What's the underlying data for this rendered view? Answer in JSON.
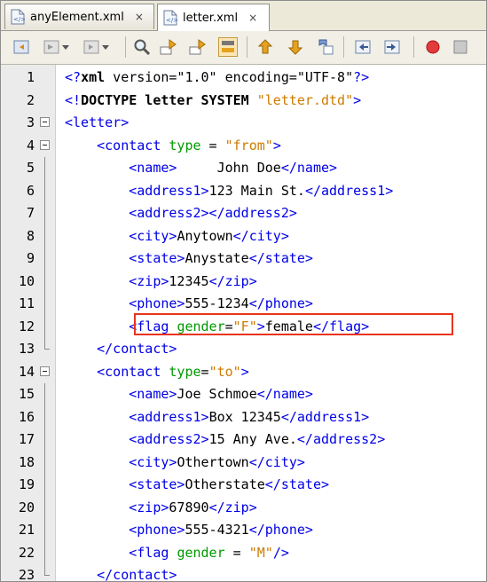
{
  "tabs": [
    {
      "label": "anyElement.xml",
      "close": "×"
    },
    {
      "label": "letter.xml",
      "close": "×"
    }
  ],
  "toolbar": {
    "icons": [
      "back-icon",
      "forward-icon",
      "history-icon",
      "find-icon",
      "find-previous-icon",
      "find-next-icon",
      "toggle-highlight-icon",
      "previous-bookmark-icon",
      "next-bookmark-icon",
      "toggle-bookmark-icon",
      "shift-left-icon",
      "shift-right-icon",
      "record-macro-icon",
      "stop-macro-icon"
    ]
  },
  "editor": {
    "lines": [
      {
        "n": "1",
        "parts": [
          [
            "tag",
            "<?"
          ],
          [
            "declkw",
            "xml"
          ],
          [
            "decl",
            " version=\"1.0\" encoding=\"UTF-8\""
          ],
          [
            "tag",
            "?>"
          ]
        ]
      },
      {
        "n": "2",
        "parts": [
          [
            "tag",
            "<!"
          ],
          [
            "declkw",
            "DOCTYPE letter SYSTEM "
          ],
          [
            "val",
            "\"letter.dtd\""
          ],
          [
            "tag",
            ">"
          ]
        ]
      },
      {
        "n": "3",
        "parts": [
          [
            "tag",
            "<letter>"
          ]
        ]
      },
      {
        "n": "4",
        "parts": [
          [
            "tag",
            "    <contact "
          ],
          [
            "attr",
            "type"
          ],
          [
            "txt",
            " = "
          ],
          [
            "val",
            "\"from\""
          ],
          [
            "tag",
            ">"
          ]
        ]
      },
      {
        "n": "5",
        "parts": [
          [
            "tag",
            "        <name>"
          ],
          [
            "txt",
            "     John Doe"
          ],
          [
            "tag",
            "</name>"
          ]
        ]
      },
      {
        "n": "6",
        "parts": [
          [
            "tag",
            "        <address1>"
          ],
          [
            "txt",
            "123 Main St."
          ],
          [
            "tag",
            "</address1>"
          ]
        ]
      },
      {
        "n": "7",
        "parts": [
          [
            "tag",
            "        <address2></address2>"
          ]
        ]
      },
      {
        "n": "8",
        "parts": [
          [
            "tag",
            "        <city>"
          ],
          [
            "txt",
            "Anytown"
          ],
          [
            "tag",
            "</city>"
          ]
        ]
      },
      {
        "n": "9",
        "parts": [
          [
            "tag",
            "        <state>"
          ],
          [
            "txt",
            "Anystate"
          ],
          [
            "tag",
            "</state>"
          ]
        ]
      },
      {
        "n": "10",
        "parts": [
          [
            "tag",
            "        <zip>"
          ],
          [
            "txt",
            "12345"
          ],
          [
            "tag",
            "</zip>"
          ]
        ]
      },
      {
        "n": "11",
        "parts": [
          [
            "tag",
            "        <phone>"
          ],
          [
            "txt",
            "555-1234"
          ],
          [
            "tag",
            "</phone>"
          ]
        ]
      },
      {
        "n": "12",
        "parts": [
          [
            "tag",
            "        <flag "
          ],
          [
            "attr",
            "gender"
          ],
          [
            "txt",
            "="
          ],
          [
            "val",
            "\"F\""
          ],
          [
            "tag",
            ">"
          ],
          [
            "txt",
            "female"
          ],
          [
            "tag",
            "</flag>"
          ]
        ]
      },
      {
        "n": "13",
        "parts": [
          [
            "tag",
            "    </contact>"
          ]
        ]
      },
      {
        "n": "14",
        "parts": [
          [
            "tag",
            "    <contact "
          ],
          [
            "attr",
            "type"
          ],
          [
            "txt",
            "="
          ],
          [
            "val",
            "\"to\""
          ],
          [
            "tag",
            ">"
          ]
        ]
      },
      {
        "n": "15",
        "parts": [
          [
            "tag",
            "        <name>"
          ],
          [
            "txt",
            "Joe Schmoe"
          ],
          [
            "tag",
            "</name>"
          ]
        ]
      },
      {
        "n": "16",
        "parts": [
          [
            "tag",
            "        <address1>"
          ],
          [
            "txt",
            "Box 12345"
          ],
          [
            "tag",
            "</address1>"
          ]
        ]
      },
      {
        "n": "17",
        "parts": [
          [
            "tag",
            "        <address2>"
          ],
          [
            "txt",
            "15 Any Ave."
          ],
          [
            "tag",
            "</address2>"
          ]
        ]
      },
      {
        "n": "18",
        "parts": [
          [
            "tag",
            "        <city>"
          ],
          [
            "txt",
            "Othertown"
          ],
          [
            "tag",
            "</city>"
          ]
        ]
      },
      {
        "n": "19",
        "parts": [
          [
            "tag",
            "        <state>"
          ],
          [
            "txt",
            "Otherstate"
          ],
          [
            "tag",
            "</state>"
          ]
        ]
      },
      {
        "n": "20",
        "parts": [
          [
            "tag",
            "        <zip>"
          ],
          [
            "txt",
            "67890"
          ],
          [
            "tag",
            "</zip>"
          ]
        ]
      },
      {
        "n": "21",
        "parts": [
          [
            "tag",
            "        <phone>"
          ],
          [
            "txt",
            "555-4321"
          ],
          [
            "tag",
            "</phone>"
          ]
        ]
      },
      {
        "n": "22",
        "parts": [
          [
            "tag",
            "        <flag "
          ],
          [
            "attr",
            "gender"
          ],
          [
            "txt",
            " = "
          ],
          [
            "val",
            "\"M\""
          ],
          [
            "tag",
            "/>"
          ]
        ]
      },
      {
        "n": "23",
        "parts": [
          [
            "tag",
            "    </contact>"
          ]
        ]
      }
    ]
  },
  "colors": {
    "tag": "#0000e6",
    "attr": "#009a00",
    "value": "#ce7b00",
    "highlight": "#e8341c"
  }
}
